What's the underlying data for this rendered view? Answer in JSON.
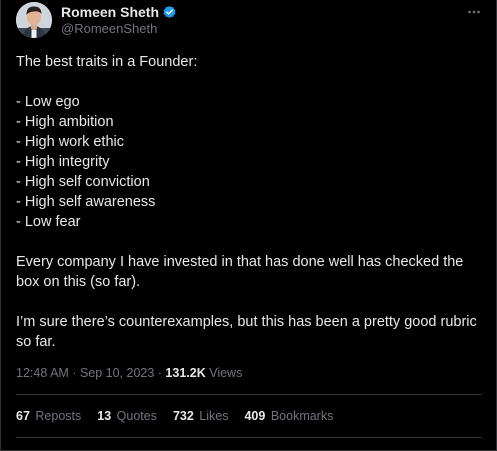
{
  "author": {
    "display_name": "Romeen Sheth",
    "handle": "@RomeenSheth",
    "verified_badge_color": "#1d9bf0"
  },
  "tweet": {
    "lines": [
      "The best traits in a Founder:",
      "",
      "- Low ego",
      "- High ambition",
      "- High work ethic",
      "- High integrity",
      "- High self conviction",
      "- High self awareness",
      "- Low fear",
      "",
      "Every company I have invested in that has done well has checked the",
      "box on this (so far).",
      "",
      "I’m sure there’s counterexamples, but this has been a pretty good rubric",
      "so far."
    ]
  },
  "meta": {
    "time": "12:48 AM",
    "separator": " · ",
    "date": "Sep 10, 2023",
    "views_count": "131.2K",
    "views_label": " Views"
  },
  "stats": [
    {
      "count": "67",
      "label": "Reposts"
    },
    {
      "count": "13",
      "label": "Quotes"
    },
    {
      "count": "732",
      "label": "Likes"
    },
    {
      "count": "409",
      "label": "Bookmarks"
    }
  ],
  "icons": {
    "more": "more-dots-icon",
    "verified": "verified-badge-icon"
  },
  "colors": {
    "background": "#000000",
    "text_primary": "#e7e9ea",
    "text_secondary": "#71767b",
    "divider": "#2f3336"
  }
}
